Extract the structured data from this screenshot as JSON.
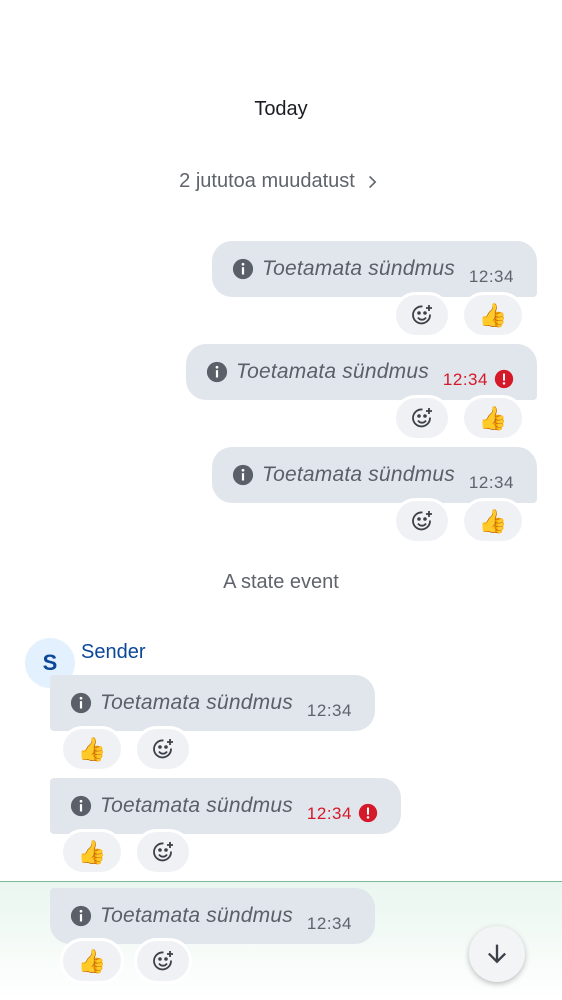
{
  "timeline": {
    "day_divider": "Today",
    "room_changes": "2 jututoa muudatust",
    "state_event": "A state event",
    "sender": {
      "name": "Sender",
      "avatar_initial": "S"
    }
  },
  "messages": [
    {
      "text": "Toetamata sündmus",
      "time": "12:34",
      "error": false,
      "reaction": "👍"
    },
    {
      "text": "Toetamata sündmus",
      "time": "12:34",
      "error": true,
      "reaction": "👍"
    },
    {
      "text": "Toetamata sündmus",
      "time": "12:34",
      "error": false,
      "reaction": "👍"
    },
    {
      "text": "Toetamata sündmus",
      "time": "12:34",
      "error": false,
      "reaction": "👍"
    },
    {
      "text": "Toetamata sündmus",
      "time": "12:34",
      "error": true,
      "reaction": "👍"
    },
    {
      "text": "Toetamata sündmus",
      "time": "12:34",
      "error": false,
      "reaction": "👍"
    }
  ],
  "colors": {
    "bubble": "#e1e5ec",
    "error": "#d51928",
    "sender_name": "#0b4799",
    "composer_border": "#7fb89a"
  }
}
